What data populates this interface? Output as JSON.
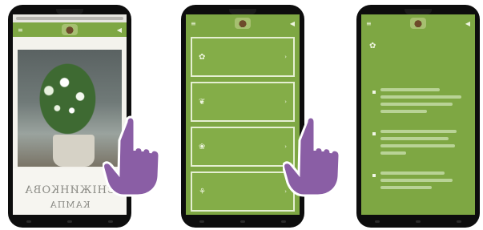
{
  "phone1": {
    "title_line1": "СНІЖИНКОВА",
    "title_line2": "КАМПА"
  },
  "phone2": {
    "menu_items": [
      {
        "label": "",
        "icon": "plant-icon"
      },
      {
        "label": "",
        "icon": "leaf-icon"
      },
      {
        "label": "",
        "icon": "flower-icon"
      },
      {
        "label": "",
        "icon": "pot-icon"
      }
    ]
  },
  "phone3": {
    "section_title": "",
    "bullets": [
      {
        "lines": 3
      },
      {
        "lines": 3
      },
      {
        "lines": 2
      }
    ]
  },
  "colors": {
    "app_green": "#7ea743",
    "hand_purple": "#8a5ea5"
  }
}
